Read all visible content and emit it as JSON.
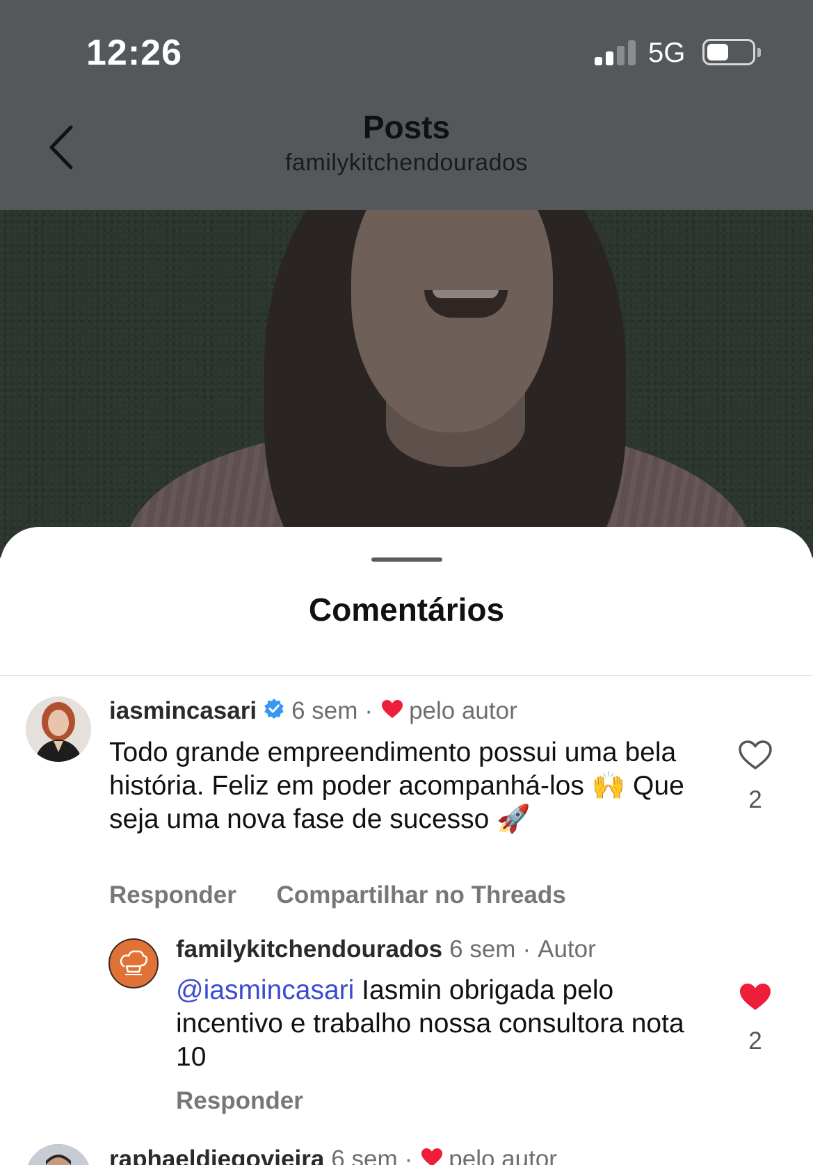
{
  "status_bar": {
    "time": "12:26",
    "network": "5G"
  },
  "header": {
    "title": "Posts",
    "subtitle": "familykitchendourados"
  },
  "comments_sheet": {
    "title": "Comentários",
    "comments": [
      {
        "username": "iasmincasari",
        "verified": true,
        "time": "6 sem",
        "separator": "·",
        "liked_by_author_label": "pelo autor",
        "text": "Todo grande empreendimento possui uma bela história. Feliz em poder acompanhá-los 🙌 Que seja uma nova fase de sucesso 🚀",
        "likes": "2",
        "liked": false,
        "reply_label": "Responder",
        "share_label": "Compartilhar no Threads",
        "replies": [
          {
            "username": "familykitchendourados",
            "time": "6 sem",
            "separator": "·",
            "role": "Autor",
            "mention": "@iasmincasari",
            "text": "Iasmin obrigada pelo incentivo e trabalho nossa consultora nota 10",
            "likes": "2",
            "liked": true,
            "liked_color": "#ee1d3a",
            "reply_label": "Responder"
          }
        ]
      },
      {
        "username": "raphaeldiegovieira",
        "time": "6 sem",
        "separator": "·",
        "liked_by_author_label": "pelo autor"
      }
    ]
  }
}
